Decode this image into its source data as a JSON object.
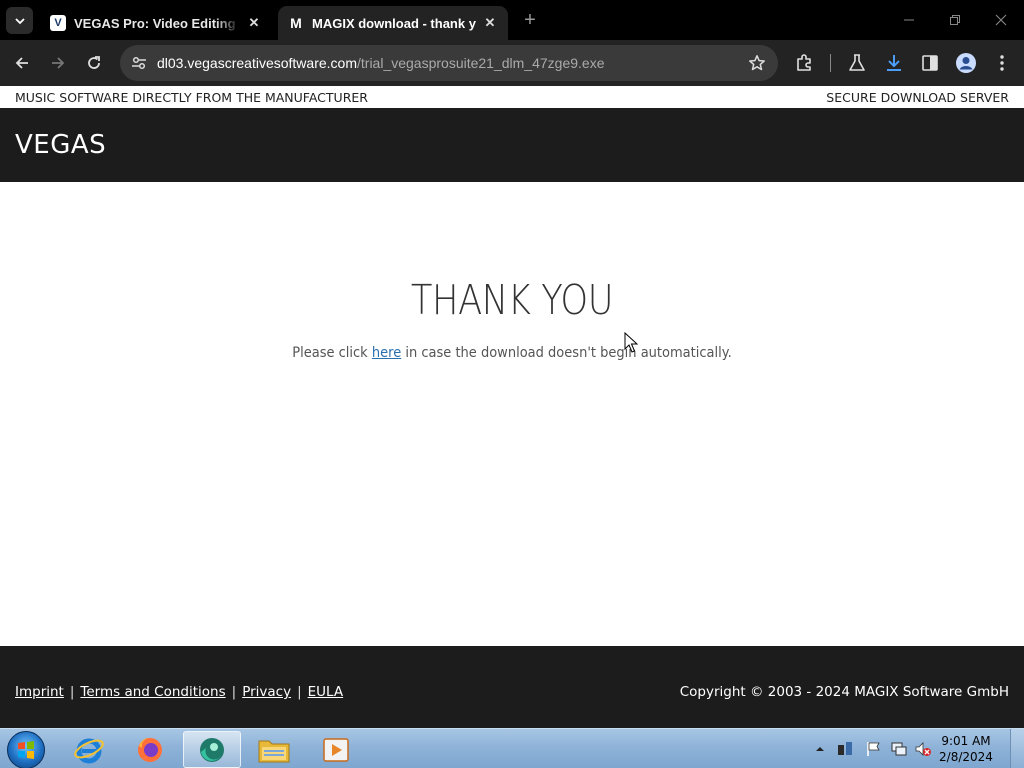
{
  "browser": {
    "tabs": [
      {
        "title": "VEGAS Pro: Video Editing Software",
        "favicon": "V",
        "active": false
      },
      {
        "title": "MAGIX download - thank you",
        "favicon": "M",
        "active": true
      }
    ],
    "new_tab_symbol": "+",
    "url_host": "dl03.vegascreativesoftware.com",
    "url_path": "/trial_vegasprosuite21_dlm_47zge9.exe"
  },
  "page": {
    "topbar_left": "MUSIC SOFTWARE DIRECTLY FROM THE MANUFACTURER",
    "topbar_right": "SECURE DOWNLOAD SERVER",
    "logo": "VEGAS",
    "headline": "THANK YOU",
    "message_before": "Please click ",
    "message_link": "here",
    "message_after": " in case the download doesn't begin automatically.",
    "footer_links": [
      "Imprint",
      "Terms and Conditions",
      "Privacy",
      "EULA"
    ],
    "footer_separator": "|",
    "copyright": "Copyright © 2003 - 2024 MAGIX Software GmbH"
  },
  "taskbar": {
    "apps": [
      "internet-explorer",
      "firefox",
      "browser-app",
      "file-explorer",
      "media-player"
    ],
    "clock_time": "9:01 AM",
    "clock_date": "2/8/2024"
  },
  "colors": {
    "dark_bar": "#1c1c1c",
    "link": "#2a6fb0",
    "download_accent": "#4da3ff"
  }
}
